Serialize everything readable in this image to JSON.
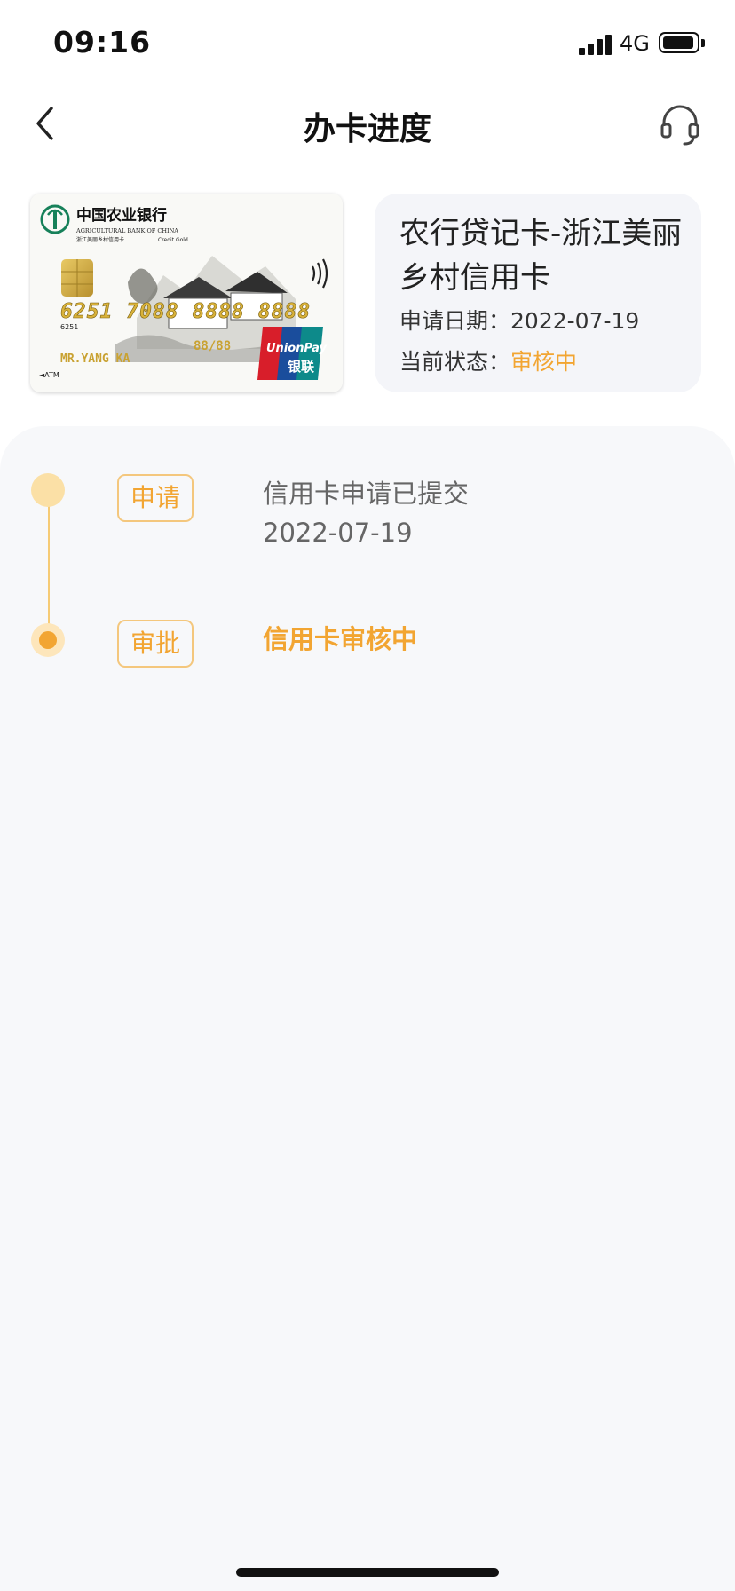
{
  "status_bar": {
    "time": "09:16",
    "network": "4G"
  },
  "nav": {
    "title": "办卡进度",
    "back_icon": "chevron-left-icon",
    "service_icon": "headset-icon"
  },
  "card": {
    "image": {
      "bank_name_cn": "中国农业银行",
      "bank_name_en": "AGRICULTURAL BANK OF CHINA",
      "card_subtitle": "浙江美丽乡村信用卡",
      "card_tier": "Credit Gold",
      "number": "6251 7088 8888 8888",
      "number_prefix": "6251",
      "expiry": "88/88",
      "holder": "MR.YANG KA",
      "atm_label": "◄ATM",
      "network_en": "UnionPay",
      "network_cn": "银联"
    },
    "name": "农行贷记卡-浙江美丽乡村信用卡",
    "apply_date_label": "申请日期：",
    "apply_date": "2022-07-19",
    "status_label": "当前状态：",
    "status": "审核中"
  },
  "timeline": [
    {
      "tag": "申请",
      "text": "信用卡申请已提交",
      "date": "2022-07-19"
    },
    {
      "tag": "审批",
      "text": "信用卡审核中"
    }
  ],
  "colors": {
    "accent": "#f2a532",
    "accent_light": "#fbe0a6",
    "panel_bg": "#f7f8fa",
    "info_bg": "#f4f5f9"
  }
}
